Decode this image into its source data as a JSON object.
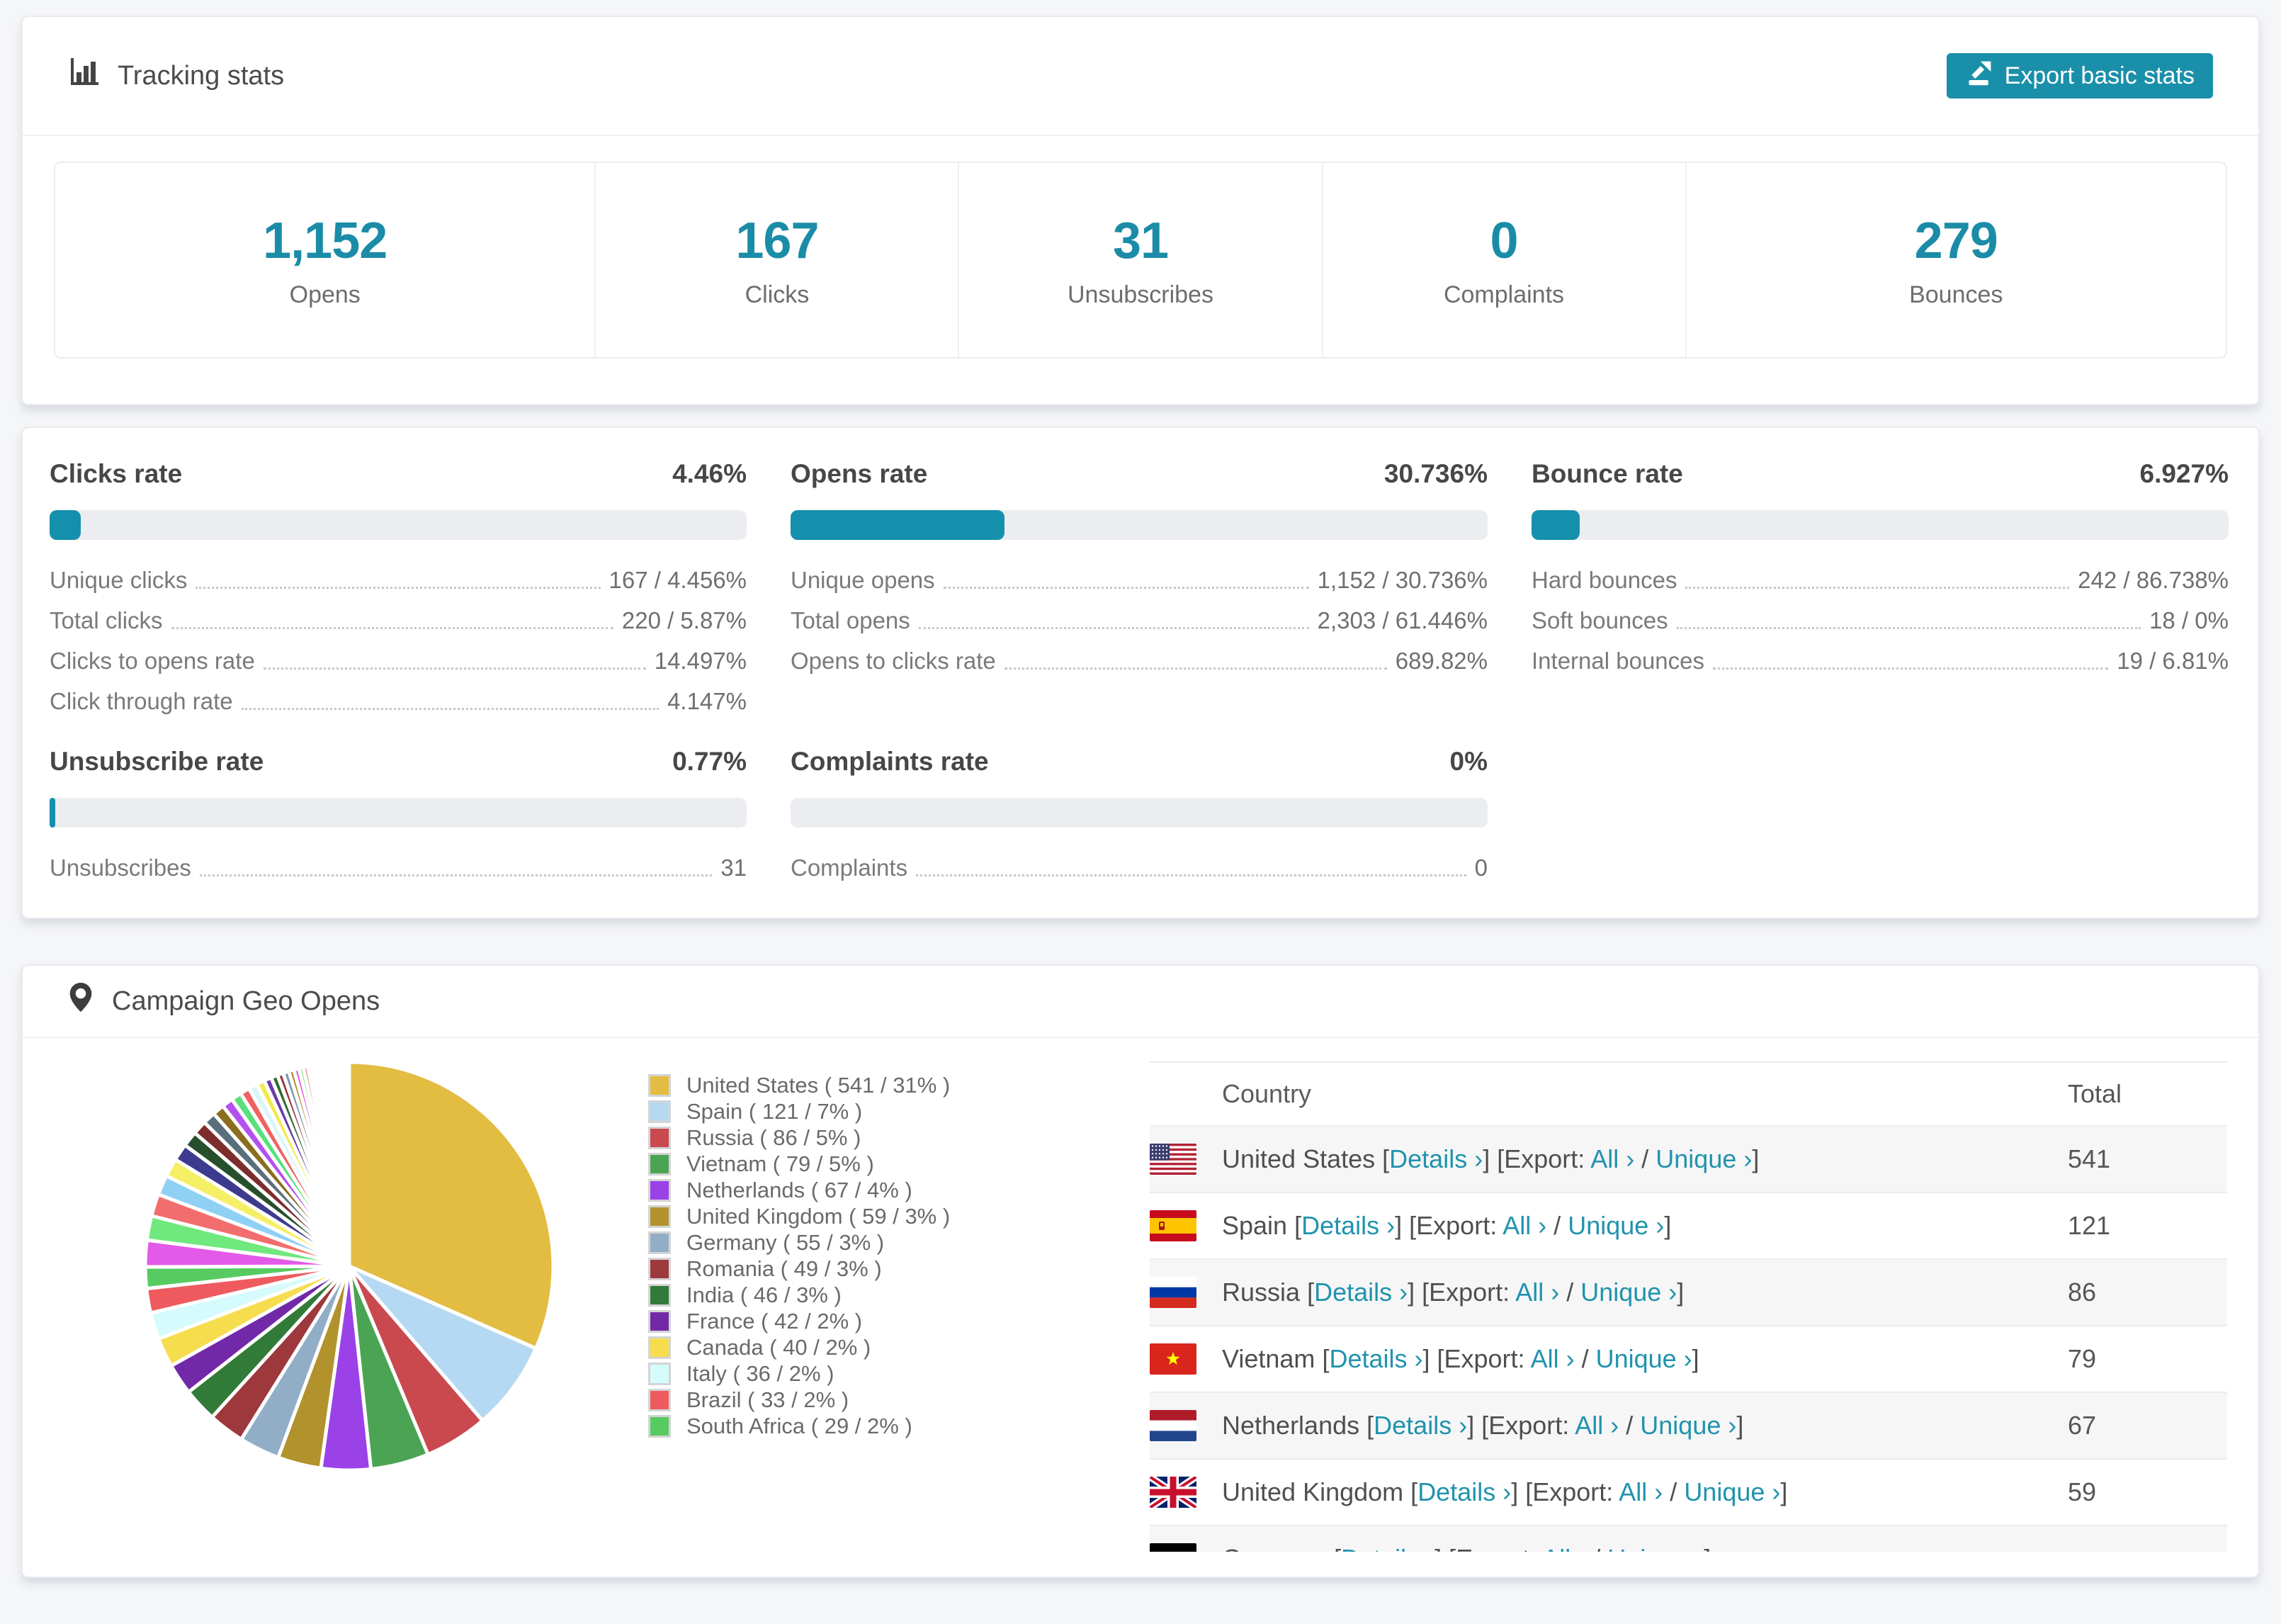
{
  "accent": "#1a8fa9",
  "tracking": {
    "title": "Tracking stats",
    "export_label": "Export basic stats",
    "stats": [
      {
        "value": "1,152",
        "label": "Opens"
      },
      {
        "value": "167",
        "label": "Clicks"
      },
      {
        "value": "31",
        "label": "Unsubscribes"
      },
      {
        "value": "0",
        "label": "Complaints"
      },
      {
        "value": "279",
        "label": "Bounces"
      }
    ]
  },
  "rates": [
    {
      "title": "Clicks rate",
      "value": "4.46%",
      "percent": 4.46,
      "rows": [
        {
          "label": "Unique clicks",
          "value": "167 / 4.456%"
        },
        {
          "label": "Total clicks",
          "value": "220 / 5.87%"
        },
        {
          "label": "Clicks to opens rate",
          "value": "14.497%"
        },
        {
          "label": "Click through rate",
          "value": "4.147%"
        }
      ]
    },
    {
      "title": "Opens rate",
      "value": "30.736%",
      "percent": 30.736,
      "rows": [
        {
          "label": "Unique opens",
          "value": "1,152 / 30.736%"
        },
        {
          "label": "Total opens",
          "value": "2,303 / 61.446%"
        },
        {
          "label": "Opens to clicks rate",
          "value": "689.82%"
        }
      ]
    },
    {
      "title": "Bounce rate",
      "value": "6.927%",
      "percent": 6.927,
      "rows": [
        {
          "label": "Hard bounces",
          "value": "242 / 86.738%"
        },
        {
          "label": "Soft bounces",
          "value": "18 / 0%"
        },
        {
          "label": "Internal bounces",
          "value": "19 / 6.81%"
        }
      ]
    },
    {
      "title": "Unsubscribe rate",
      "value": "0.77%",
      "percent": 0.77,
      "rows": [
        {
          "label": "Unsubscribes",
          "value": "31"
        }
      ]
    },
    {
      "title": "Complaints rate",
      "value": "0%",
      "percent": 0,
      "rows": [
        {
          "label": "Complaints",
          "value": "0"
        }
      ]
    }
  ],
  "geo": {
    "title": "Campaign Geo Opens",
    "table": {
      "columns": [
        "Country",
        "Total"
      ],
      "link_labels": {
        "details": "Details ›",
        "export_word": "Export:",
        "all": "All ›",
        "unique": "Unique ›"
      },
      "rows": [
        {
          "flag": "us",
          "country": "United States",
          "total": "541"
        },
        {
          "flag": "es",
          "country": "Spain",
          "total": "121"
        },
        {
          "flag": "ru",
          "country": "Russia",
          "total": "86"
        },
        {
          "flag": "vn",
          "country": "Vietnam",
          "total": "79"
        },
        {
          "flag": "nl",
          "country": "Netherlands",
          "total": "67"
        },
        {
          "flag": "gb",
          "country": "United Kingdom",
          "total": "59"
        },
        {
          "flag": "de",
          "country": "Germany",
          "total": ""
        }
      ]
    }
  },
  "chart_data": {
    "type": "pie",
    "title": "Campaign Geo Opens",
    "legend_position": "right of pie",
    "series": [
      {
        "name": "United States",
        "value": 541,
        "pct": "31%",
        "color": "#e3bc42"
      },
      {
        "name": "Spain",
        "value": 121,
        "pct": "7%",
        "color": "#b5d9f3"
      },
      {
        "name": "Russia",
        "value": 86,
        "pct": "5%",
        "color": "#c9494e"
      },
      {
        "name": "Vietnam",
        "value": 79,
        "pct": "5%",
        "color": "#4ba454"
      },
      {
        "name": "Netherlands",
        "value": 67,
        "pct": "4%",
        "color": "#9a41e8"
      },
      {
        "name": "United Kingdom",
        "value": 59,
        "pct": "3%",
        "color": "#b2922d"
      },
      {
        "name": "Germany",
        "value": 55,
        "pct": "3%",
        "color": "#92aec7"
      },
      {
        "name": "Romania",
        "value": 49,
        "pct": "3%",
        "color": "#9d393d"
      },
      {
        "name": "India",
        "value": 46,
        "pct": "3%",
        "color": "#327a38"
      },
      {
        "name": "France",
        "value": 42,
        "pct": "2%",
        "color": "#7129a8"
      },
      {
        "name": "Canada",
        "value": 40,
        "pct": "2%",
        "color": "#f6dd4d"
      },
      {
        "name": "Italy",
        "value": 36,
        "pct": "2%",
        "color": "#d5fbfc"
      },
      {
        "name": "Brazil",
        "value": 33,
        "pct": "2%",
        "color": "#ee5a5e"
      },
      {
        "name": "South Africa",
        "value": 29,
        "pct": "2%",
        "color": "#57cb61"
      }
    ],
    "others_unlabeled_slices": {
      "note": "many small unlabeled countries, drawn as progressively thinner slices",
      "values": [
        36,
        33,
        30,
        27,
        25,
        23,
        21,
        19,
        17,
        16,
        15,
        14,
        13,
        12,
        11,
        10,
        9,
        8,
        8,
        7,
        7,
        6,
        6,
        5,
        5,
        4,
        4,
        4,
        3,
        3,
        3,
        3,
        2,
        2,
        2,
        2,
        2,
        2,
        1,
        1,
        1,
        1,
        1,
        1,
        1,
        1,
        1,
        1
      ],
      "palette": [
        "#e35ae8",
        "#6fe87d",
        "#f26d6d",
        "#8fd0f5",
        "#f5ef66",
        "#3d3b8e",
        "#274f2b",
        "#7c2d2d",
        "#5a6f7c",
        "#8a6d1f",
        "#b44ff0",
        "#59e07c",
        "#f06262",
        "#d9f7fa",
        "#f2e94e",
        "#6a3ba8",
        "#2f6b34",
        "#963b3b",
        "#7d97ab",
        "#a8891f"
      ]
    }
  }
}
